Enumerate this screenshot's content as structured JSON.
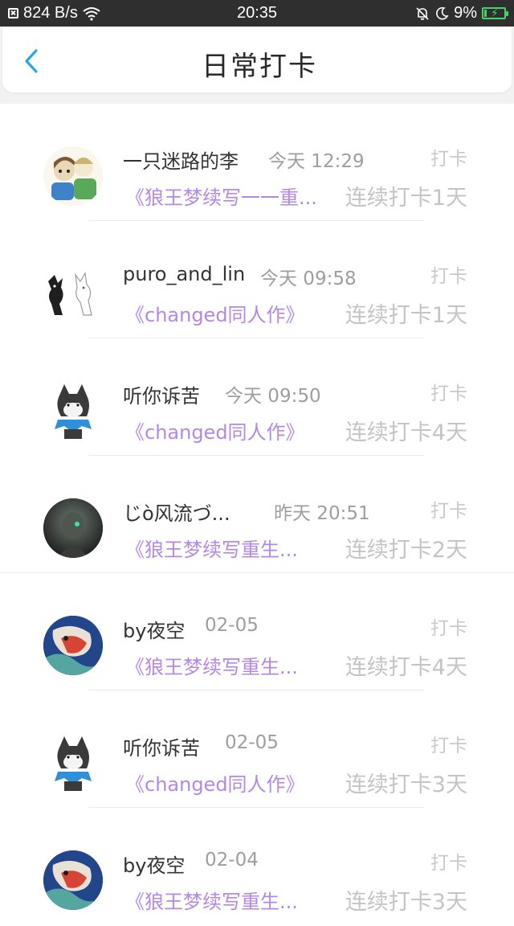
{
  "status_bar": {
    "speed": "824 B/s",
    "time": "20:35",
    "battery": "9%"
  },
  "header": {
    "title": "日常打卡",
    "back_icon": "chevron-left-icon",
    "back_color": "#2aa7e6"
  },
  "checkins": [
    {
      "user": "一只迷路的李",
      "time": "今天 12:29",
      "action": "打卡",
      "book": "《狼王梦续写一一重...",
      "streak": "连续打卡1天"
    },
    {
      "user": "puro_and_lin",
      "time": "今天 09:58",
      "action": "打卡",
      "book": "《changed同人作》",
      "streak": "连续打卡1天"
    },
    {
      "user": "听你诉苦",
      "time": "今天 09:50",
      "action": "打卡",
      "book": "《changed同人作》",
      "streak": "连续打卡4天"
    },
    {
      "user": "じò风流づ...",
      "time": "昨天 20:51",
      "action": "打卡",
      "book": "《狼王梦续写重生...",
      "streak": "连续打卡2天"
    },
    {
      "user": "by夜空",
      "time": "02-05",
      "action": "打卡",
      "book": "《狼王梦续写重生...",
      "streak": "连续打卡4天"
    },
    {
      "user": "听你诉苦",
      "time": "02-05",
      "action": "打卡",
      "book": "《changed同人作》",
      "streak": "连续打卡3天"
    },
    {
      "user": "by夜空",
      "time": "02-04",
      "action": "打卡",
      "book": "《狼王梦续写重生...",
      "streak": "连续打卡3天"
    }
  ]
}
